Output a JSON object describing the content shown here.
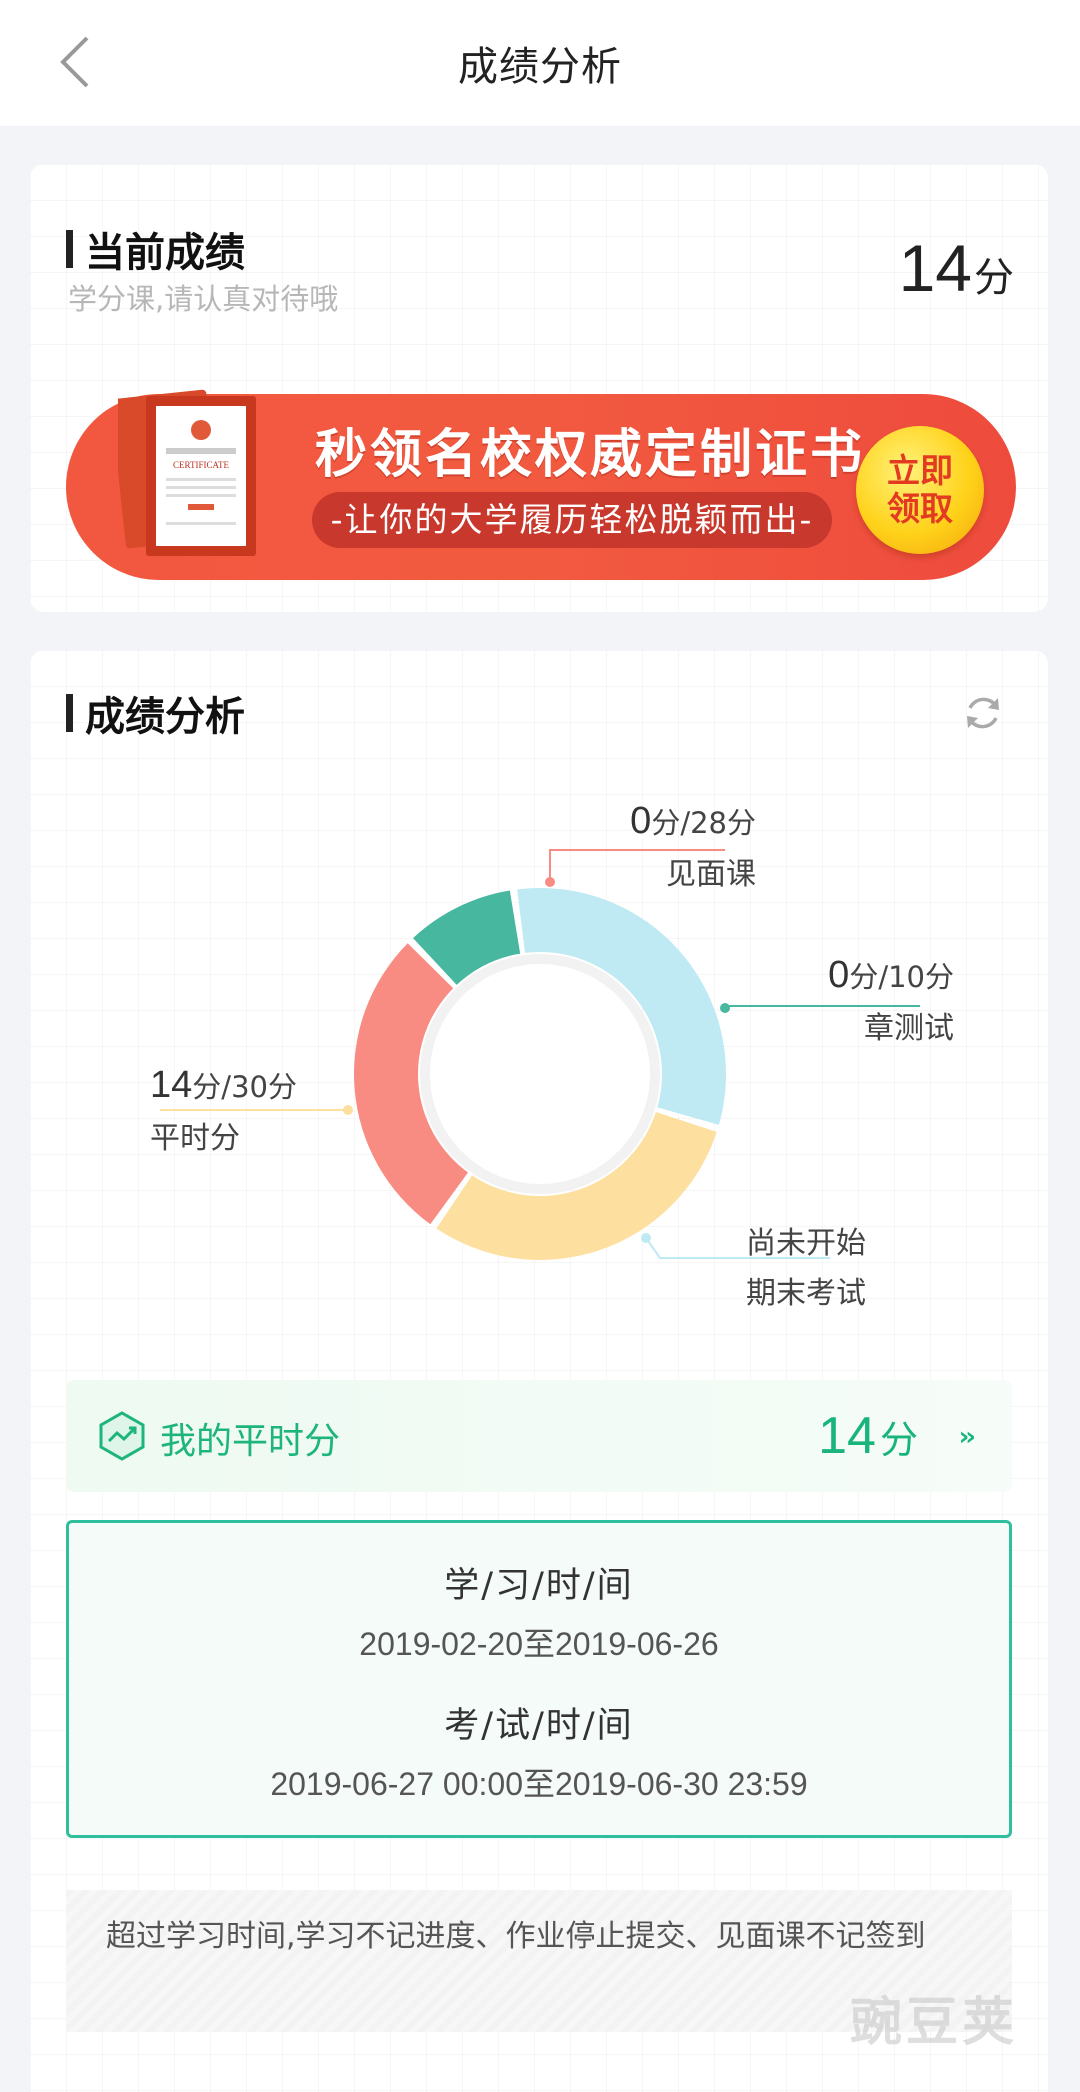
{
  "nav": {
    "title": "成绩分析"
  },
  "current": {
    "title": "当前成绩",
    "subtitle": "学分课,请认真对待哦",
    "score": "14",
    "unit": "分"
  },
  "banner": {
    "headline": "秒领名校权威定制证书",
    "sub": "-让你的大学履历轻松脱颖而出-",
    "claim_line1": "立即",
    "claim_line2": "领取",
    "certificate_text": "CERTIFICATE"
  },
  "analysis": {
    "title": "成绩分析"
  },
  "chart_data": {
    "type": "pie",
    "donut": true,
    "slices": [
      {
        "name": "见面课",
        "value": 28,
        "score": "0",
        "total": "28分",
        "color": "#f98c82"
      },
      {
        "name": "章测试",
        "value": 10,
        "score": "0",
        "total": "10分",
        "color": "#47b89f"
      },
      {
        "name": "期末考试",
        "value": 32,
        "score": "",
        "total": "",
        "status": "尚未开始",
        "color": "#bfeaf3"
      },
      {
        "name": "平时分",
        "value": 30,
        "score": "14",
        "total": "30分",
        "color": "#fde0a0"
      }
    ],
    "unit_score": "分/"
  },
  "my_score": {
    "label": "我的平时分",
    "value": "14",
    "unit": "分",
    "arrow": "››"
  },
  "time": {
    "study_heading": "学/习/时/间",
    "study_range": "2019-02-20至2019-06-26",
    "exam_heading": "考/试/时/间",
    "exam_range": "2019-06-27 00:00至2019-06-30 23:59"
  },
  "notice": "超过学习时间,学习不记进度、作业停止提交、见面课不记签到",
  "watermark": "豌豆荚"
}
